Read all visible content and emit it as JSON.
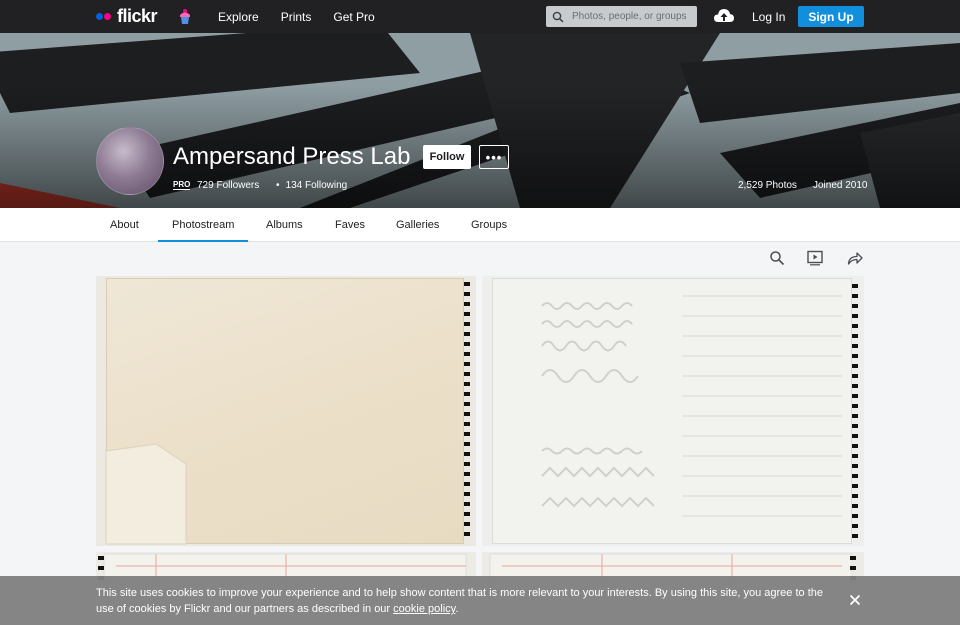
{
  "brand": {
    "name": "flickr",
    "colors": {
      "blue": "#0063dc",
      "pink": "#ff0084",
      "accent": "#128fdc",
      "nav_bg": "#212124"
    }
  },
  "topnav": {
    "links": [
      "Explore",
      "Prints",
      "Get Pro"
    ],
    "search_placeholder": "Photos, people, or groups",
    "login_label": "Log In",
    "signup_label": "Sign Up"
  },
  "profile": {
    "name": "Ampersand Press Lab",
    "follow_label": "Follow",
    "more_label": "•••",
    "pro_badge": "PRO",
    "followers": "729 Followers",
    "following_sep": "•",
    "following": "134 Following",
    "photos_count": "2,529 Photos",
    "joined": "Joined 2010"
  },
  "subnav": {
    "tabs": [
      "About",
      "Photostream",
      "Albums",
      "Faves",
      "Galleries",
      "Groups"
    ],
    "active": "Photostream"
  },
  "toolbar": {
    "icons": [
      "search-icon",
      "slideshow-icon",
      "share-icon"
    ]
  },
  "cookie": {
    "text": "This site uses cookies to improve your experience and to help show content that is more relevant to your interests. By using this site, you agree to the use of cookies by Flickr and our partners as described in our ",
    "link": "cookie policy",
    "end": "."
  }
}
